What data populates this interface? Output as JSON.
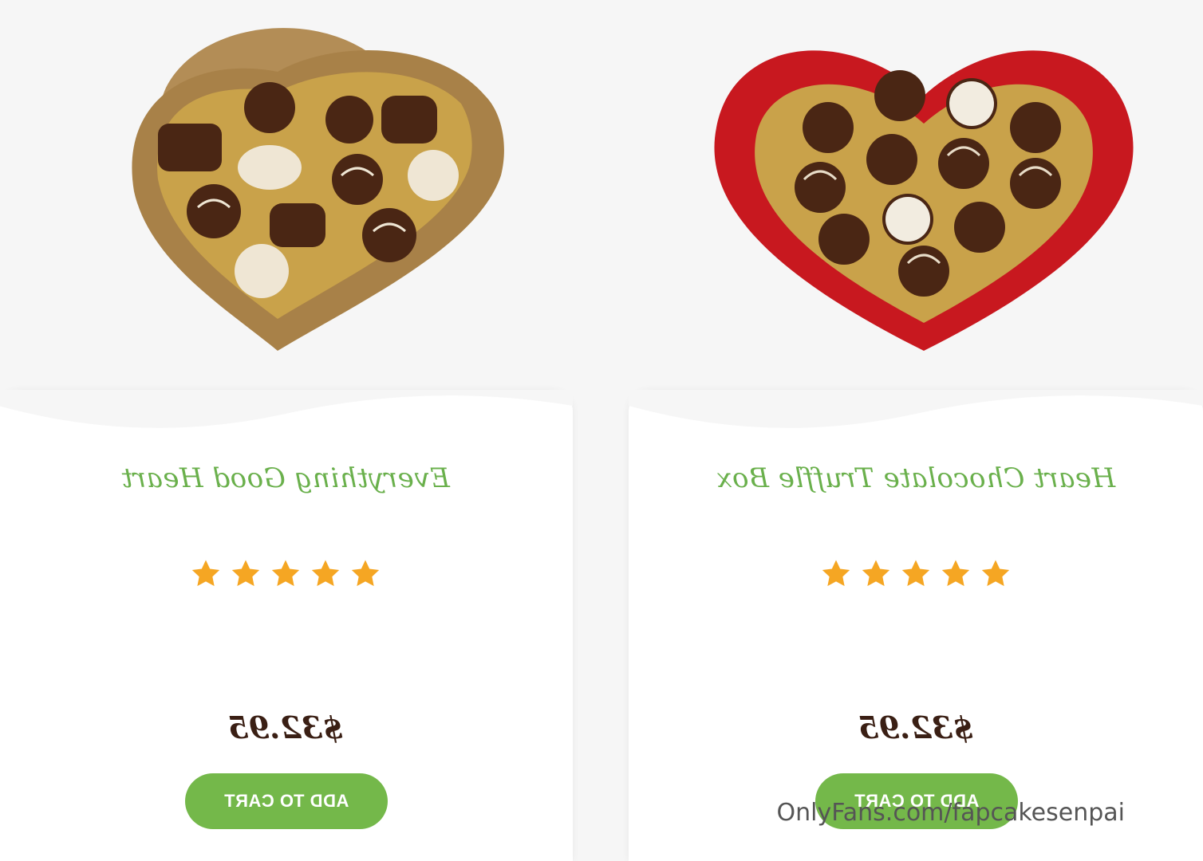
{
  "products": [
    {
      "title": "Everything Good Heart",
      "image_icon": "gold-heart-chocolate-box",
      "rating": 5,
      "rating_max": 5,
      "price": "$32.95",
      "button_label": "ADD TO CART",
      "box_color": "#b08a52"
    },
    {
      "title": "Heart Chocolate Truffle Box",
      "image_icon": "red-heart-chocolate-box",
      "rating": 5,
      "rating_max": 5,
      "price": "$32.95",
      "button_label": "ADD TO CART",
      "box_color": "#d0202a"
    }
  ],
  "watermark": "OnlyFans.com/fapcakesenpai",
  "colors": {
    "title_green": "#6ab04c",
    "button_green": "#74b84a",
    "star_orange": "#f5a623",
    "price_brown": "#3a1f14"
  }
}
